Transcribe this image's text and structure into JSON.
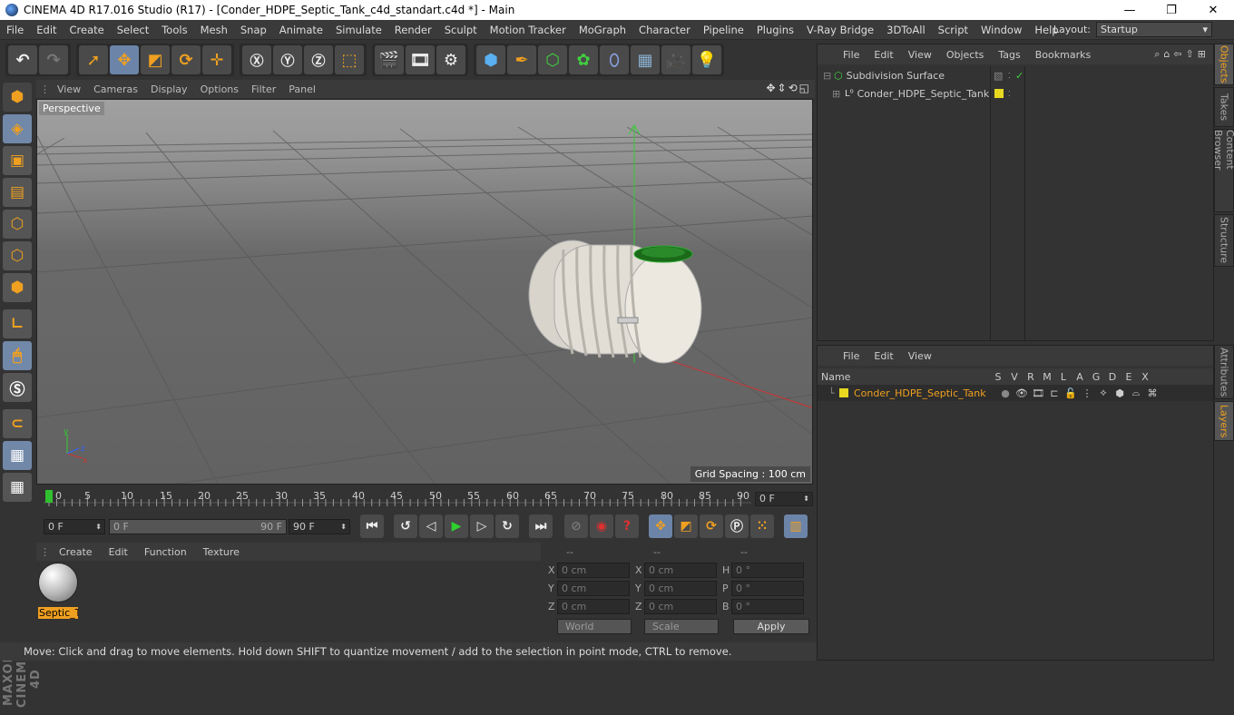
{
  "window": {
    "title": "CINEMA 4D R17.016 Studio (R17) - [Conder_HDPE_Septic_Tank_c4d_standart.c4d *] - Main",
    "minimize": "—",
    "maximize": "❐",
    "close": "✕"
  },
  "menu": {
    "items": [
      "File",
      "Edit",
      "Create",
      "Select",
      "Tools",
      "Mesh",
      "Snap",
      "Animate",
      "Simulate",
      "Render",
      "Sculpt",
      "Motion Tracker",
      "MoGraph",
      "Character",
      "Pipeline",
      "Plugins",
      "V-Ray Bridge",
      "3DToAll",
      "Script",
      "Window",
      "Help"
    ],
    "layout_label": "Layout:",
    "layout_value": "Startup"
  },
  "viewport": {
    "menu": [
      "View",
      "Cameras",
      "Display",
      "Options",
      "Filter",
      "Panel"
    ],
    "label": "Perspective",
    "grid_spacing": "Grid Spacing : 100 cm"
  },
  "timeline": {
    "ticks": [
      "0",
      "5",
      "10",
      "15",
      "20",
      "25",
      "30",
      "35",
      "40",
      "45",
      "50",
      "55",
      "60",
      "65",
      "70",
      "75",
      "80",
      "85",
      "90"
    ],
    "current_frame": "0 F",
    "start_field": "0 F",
    "slider_start": "0 F",
    "slider_end": "90 F",
    "end_field": "90 F"
  },
  "material": {
    "menu": [
      "Create",
      "Edit",
      "Function",
      "Texture"
    ],
    "name": "Septic_T"
  },
  "coords": {
    "headers": [
      "--",
      "--",
      "--"
    ],
    "rows": [
      {
        "a1": "X",
        "v1": "0 cm",
        "a2": "X",
        "v2": "0 cm",
        "a3": "H",
        "v3": "0 °"
      },
      {
        "a1": "Y",
        "v1": "0 cm",
        "a2": "Y",
        "v2": "0 cm",
        "a3": "P",
        "v3": "0 °"
      },
      {
        "a1": "Z",
        "v1": "0 cm",
        "a2": "Z",
        "v2": "0 cm",
        "a3": "B",
        "v3": "0 °"
      }
    ],
    "world": "World",
    "scale": "Scale",
    "apply": "Apply"
  },
  "status": "Move: Click and drag to move elements. Hold down SHIFT to quantize movement / add to the selection in point mode, CTRL to remove.",
  "objects": {
    "menu": [
      "File",
      "Edit",
      "View",
      "Objects",
      "Tags",
      "Bookmarks"
    ],
    "items": [
      {
        "name": "Subdivision Surface"
      },
      {
        "name": "Conder_HDPE_Septic_Tank"
      }
    ]
  },
  "layers": {
    "menu": [
      "File",
      "Edit",
      "View"
    ],
    "columns": [
      "Name",
      "S",
      "V",
      "R",
      "M",
      "L",
      "A",
      "G",
      "D",
      "E",
      "X"
    ],
    "row": "Conder_HDPE_Septic_Tank"
  },
  "side_tabs": [
    "Objects",
    "Takes",
    "Content Browser",
    "Structure",
    "Attributes",
    "Layers"
  ],
  "brand": "MAXON CINEMA 4D",
  "colors": {
    "accent": "#f0a020",
    "highlight": "#6c84a8",
    "layer_yellow": "#e8d820"
  }
}
